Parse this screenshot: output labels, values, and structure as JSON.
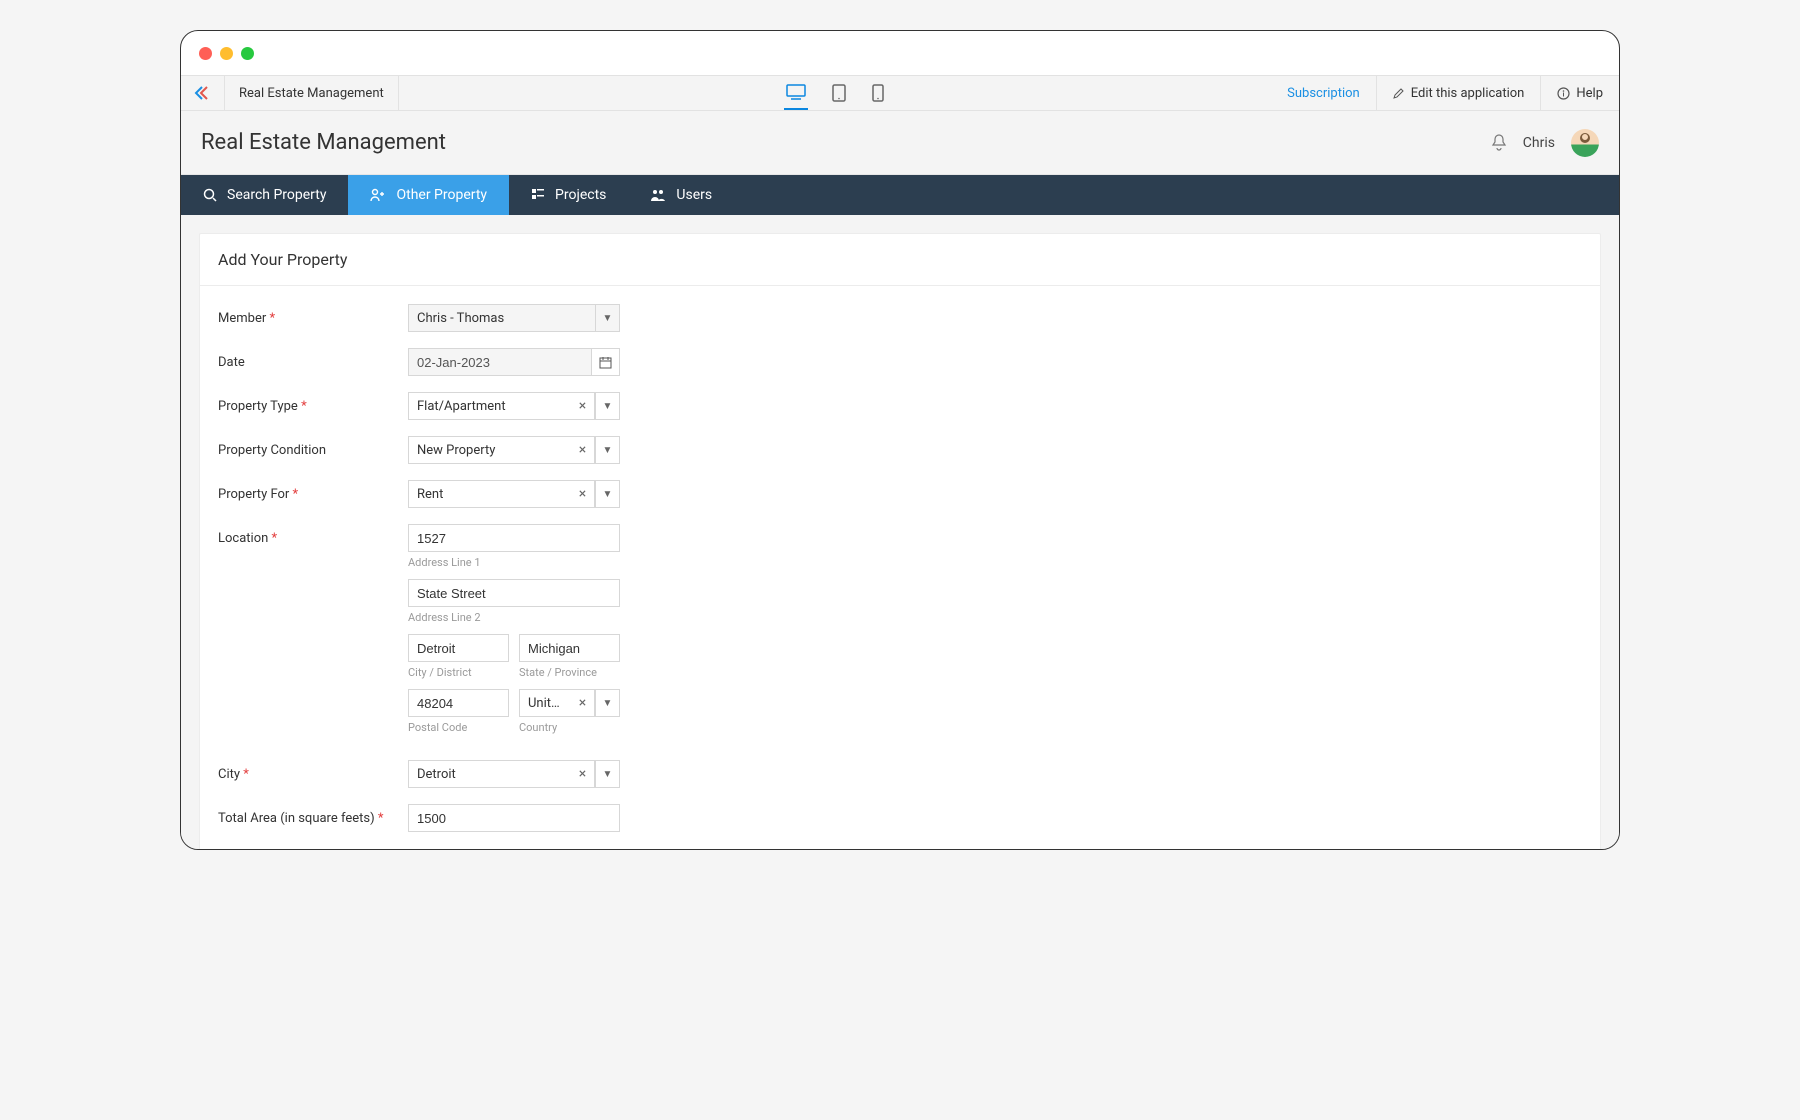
{
  "toolbar": {
    "app_name": "Real Estate Management",
    "subscription": "Subscription",
    "edit_app": "Edit this application",
    "help": "Help"
  },
  "header": {
    "title": "Real Estate Management",
    "user": "Chris"
  },
  "nav": {
    "search": "Search Property",
    "other": "Other Property",
    "projects": "Projects",
    "users": "Users"
  },
  "panel": {
    "title": "Add Your Property"
  },
  "form": {
    "member": {
      "label": "Member",
      "value": "Chris - Thomas"
    },
    "date": {
      "label": "Date",
      "value": "02-Jan-2023"
    },
    "property_type": {
      "label": "Property Type",
      "value": "Flat/Apartment"
    },
    "property_condition": {
      "label": "Property Condition",
      "value": "New Property"
    },
    "property_for": {
      "label": "Property For",
      "value": "Rent"
    },
    "location": {
      "label": "Location",
      "addr1": {
        "value": "1527",
        "sublabel": "Address Line 1"
      },
      "addr2": {
        "value": "State Street",
        "sublabel": "Address Line 2"
      },
      "city": {
        "value": "Detroit",
        "sublabel": "City / District"
      },
      "state": {
        "value": "Michigan",
        "sublabel": "State / Province"
      },
      "postal": {
        "value": "48204",
        "sublabel": "Postal Code"
      },
      "country": {
        "value": "United...",
        "sublabel": "Country"
      }
    },
    "city": {
      "label": "City",
      "value": "Detroit"
    },
    "total_area": {
      "label": "Total Area (in square feets)",
      "value": "1500"
    }
  }
}
